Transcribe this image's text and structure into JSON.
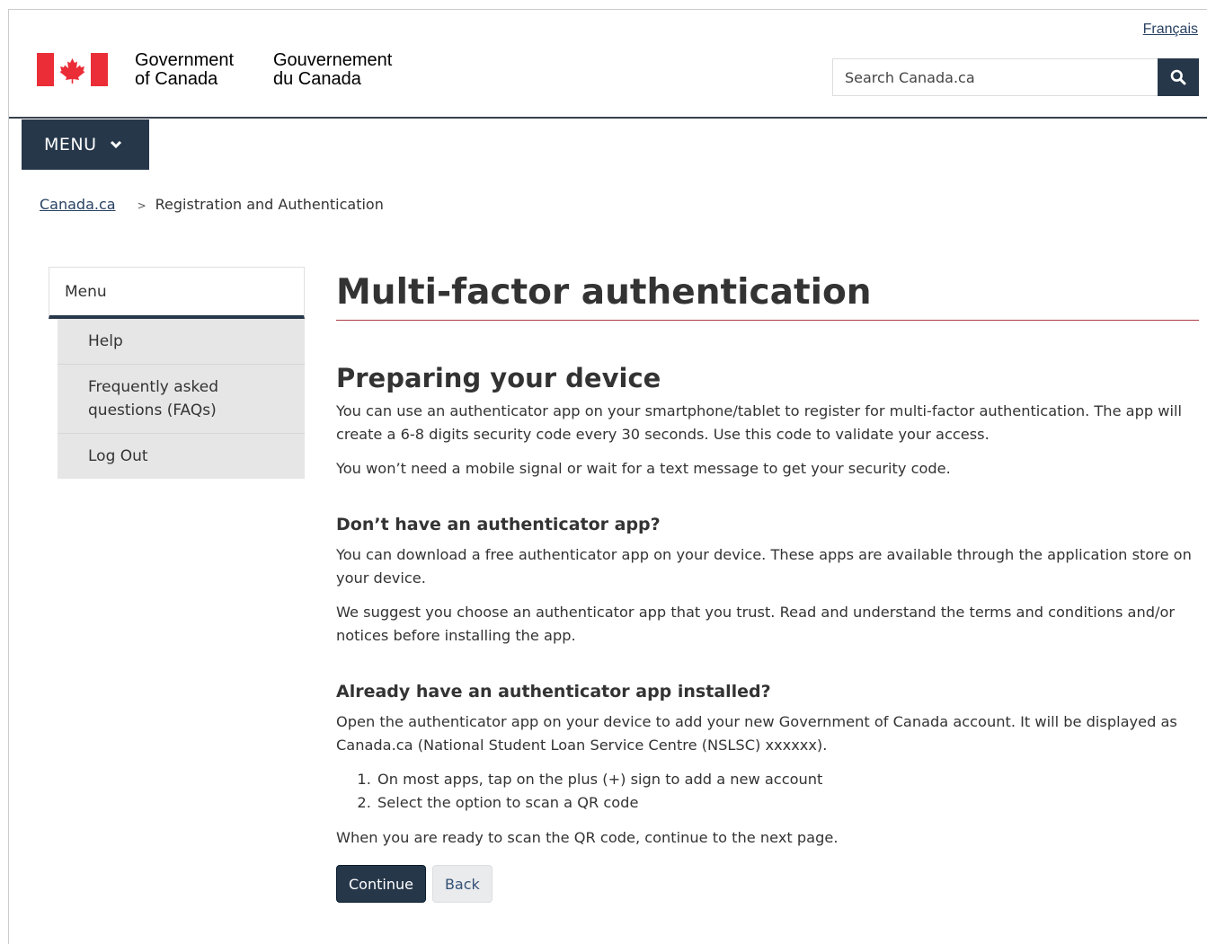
{
  "header": {
    "language_link": "Français",
    "signature_en": [
      "Government",
      "of Canada"
    ],
    "signature_fr": [
      "Gouvernement",
      "du Canada"
    ],
    "search_placeholder": "Search Canada.ca",
    "flag_color": "#eb2d37"
  },
  "menu_button": {
    "label": "MENU"
  },
  "breadcrumb": {
    "home": "Canada.ca",
    "separator": ">",
    "current": "Registration and Authentication"
  },
  "sidenav": {
    "title": "Menu",
    "items": [
      {
        "label": "Help"
      },
      {
        "label": "Frequently asked questions (FAQs)"
      },
      {
        "label": "Log Out"
      }
    ]
  },
  "main": {
    "title": "Multi-factor authentication",
    "subtitle": "Preparing your device",
    "intro_p1": "You can use an authenticator app on your smartphone/tablet to register for multi-factor authentication. The app will create a 6-8 digits security code every 30 seconds. Use this code to validate your access.",
    "intro_p2": "You won’t need a mobile signal or wait for a text message to get your security code.",
    "section1": {
      "heading": "Don’t have an authenticator app?",
      "p1": "You can download a free authenticator app on your device. These apps are available through the application store on your device.",
      "p2": "We suggest you choose an authenticator app that you trust. Read and understand the terms and conditions and/or notices before installing the app."
    },
    "section2": {
      "heading": "Already have an authenticator app installed?",
      "p1": "Open the authenticator app on your device to add your new Government of Canada account. It will be displayed as Canada.ca (National Student Loan Service Centre (NSLSC) xxxxxx).",
      "steps": [
        "On most apps, tap on the plus (+) sign to add a new account",
        "Select the option to scan a QR code"
      ],
      "p2": "When you are ready to scan the QR code, continue to the next page."
    },
    "buttons": {
      "continue": "Continue",
      "back": "Back"
    }
  },
  "colors": {
    "brand_dark": "#26374a",
    "link": "#284162",
    "h1_rule": "#af3c43"
  }
}
